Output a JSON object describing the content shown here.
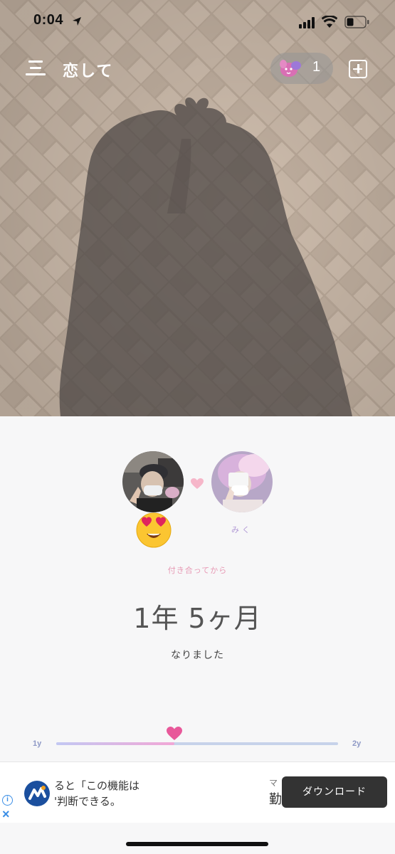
{
  "status_bar": {
    "time": "0:04",
    "icons": [
      "location-arrow-icon",
      "cellular-signal-icon",
      "wifi-icon",
      "battery-icon"
    ]
  },
  "nav": {
    "menu_label": "三",
    "title": "恋して",
    "points_count": "1",
    "icons": [
      "menu-icon",
      "mascot-icon",
      "add-icon"
    ]
  },
  "couple": {
    "partner_name": "みく",
    "mood_emoji": "😍",
    "icons": [
      "heart-icon"
    ]
  },
  "anniversary": {
    "since_label": "付き合ってから",
    "duration": "1年 5ヶ月",
    "became_label": "なりました"
  },
  "timeline": {
    "start_label": "1y",
    "end_label": "2y",
    "progress": 0.42
  },
  "ad": {
    "text": "ると「この機能は\n'判断できる。",
    "right_text_top": "マ",
    "right_text_bottom": "勤",
    "button_label": "ダウンロード",
    "info_icon": "i",
    "close_icon": "×"
  },
  "colors": {
    "accent_pink": "#e8589a",
    "label_pink": "#e79ab5",
    "label_purple": "#b29ad6",
    "track": "#c7d2ea"
  }
}
